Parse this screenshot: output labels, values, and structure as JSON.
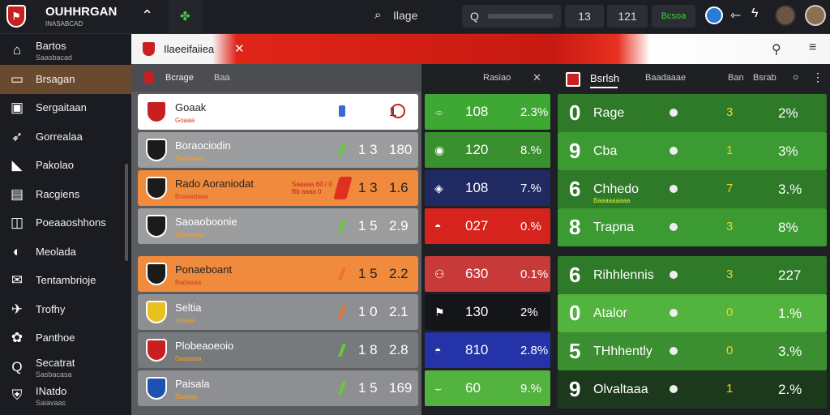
{
  "app": {
    "title": "OUHHRGAN",
    "subtitle": "INASABCAD"
  },
  "topbar": {
    "search_label": "Ilage",
    "search2_placeholder": "Q",
    "box1": "13",
    "box2": "121",
    "box3": "Bcsoa"
  },
  "sidebar": {
    "items": [
      {
        "label": "Bartos",
        "sub": "Saasbacad",
        "icon": "home-icon"
      },
      {
        "label": "Brsagan",
        "sub": "",
        "icon": "wallet-icon"
      },
      {
        "label": "Sergaitaan",
        "sub": "",
        "icon": "card-icon"
      },
      {
        "label": "Gorrealaa",
        "sub": "",
        "icon": "arrow-icon"
      },
      {
        "label": "Pakolao",
        "sub": "",
        "icon": "shoe-icon"
      },
      {
        "label": "Racgiens",
        "sub": "",
        "icon": "news-icon"
      },
      {
        "label": "Poeaaoshhons",
        "sub": "",
        "icon": "square-icon"
      },
      {
        "label": "Meolada",
        "sub": "",
        "icon": "shield-icon"
      },
      {
        "label": "Tentambrioje",
        "sub": "",
        "icon": "mail-icon"
      },
      {
        "label": "Trofhy",
        "sub": "",
        "icon": "plane-icon"
      },
      {
        "label": "Panthoe",
        "sub": "",
        "icon": "gear-icon"
      },
      {
        "label": "Secatrat",
        "sub": "Sasbacasa",
        "icon": "q-icon"
      },
      {
        "label": "INatdo",
        "sub": "Saiavaas",
        "icon": "club-crest-icon"
      }
    ]
  },
  "banner": {
    "title": "Ilaeeifaiiea"
  },
  "left_panel": {
    "header": {
      "col1": "Bcrage",
      "col2": "Baa",
      "col3": "Rasiao"
    },
    "rows": [
      {
        "team": "Goaak",
        "sub": "Goaaa",
        "v1": "",
        "v2": "1",
        "bg": "#ffffff",
        "fg": "#222",
        "crest": "#c82020"
      },
      {
        "team": "Boraociodin",
        "sub": "Baaaaaaa",
        "v1": "1 3",
        "v2": "180",
        "bg": "#9c9d9f",
        "fg": "#fff",
        "crest": "#1b1b1b"
      },
      {
        "team": "Rado Aoraniodat",
        "sub": "Boaaadaaa",
        "v1": "1 3",
        "v2": "1.6",
        "bg": "#f08a3c",
        "fg": "#222",
        "crest": "#1b1b1b",
        "note": "Saaaaa 60 / 0 Bb aaaa 0"
      },
      {
        "team": "Saoaoboonie",
        "sub": "Baaaaaaa",
        "v1": "1 5",
        "v2": "2.9",
        "bg": "#9c9d9f",
        "fg": "#fff",
        "crest": "#1b1b1b"
      },
      {
        "team": "Ponaeboant",
        "sub": "Badaaaa",
        "v1": "1 5",
        "v2": "2.2",
        "bg": "#f08a3c",
        "fg": "#222",
        "crest": "#1b1b1b"
      },
      {
        "team": "Seltia",
        "sub": "Ionaaa",
        "v1": "1 0",
        "v2": "2.1",
        "bg": "#8e8f92",
        "fg": "#fff",
        "crest": "#e8c020"
      },
      {
        "team": "Plobeaoeoio",
        "sub": "Daaaaaa",
        "v1": "1 8",
        "v2": "2.8",
        "bg": "#777a7d",
        "fg": "#fff",
        "crest": "#c82020"
      },
      {
        "team": "Paisala",
        "sub": "Bbaaaa",
        "v1": "1 5",
        "v2": "169",
        "bg": "#8e8f92",
        "fg": "#fff",
        "crest": "#2050b0"
      }
    ]
  },
  "middle": {
    "rows": [
      {
        "a": "108",
        "b": "2.3%",
        "bg": "#3fa834"
      },
      {
        "a": "120",
        "b": "8.%",
        "bg": "#3a8f2e"
      },
      {
        "a": "108",
        "b": "7.%",
        "bg": "#1f2a63"
      },
      {
        "a": "027",
        "b": "0.%",
        "bg": "#d6231d"
      },
      {
        "a": "630",
        "b": "0.1%",
        "bg": "#c83a3a"
      },
      {
        "a": "130",
        "b": "2%",
        "bg": "#141518"
      },
      {
        "a": "810",
        "b": "2.8%",
        "bg": "#2433a8"
      },
      {
        "a": "60",
        "b": "9.%",
        "bg": "#52b33e"
      }
    ]
  },
  "right_panel": {
    "header": {
      "title": "Bsrlsh",
      "col2": "Baadaaae",
      "col3": "Ban",
      "col4": "Bsrab"
    },
    "rows": [
      {
        "big": "0",
        "name": "Rage",
        "m": "3",
        "pct": "2%",
        "bg": "#2f7a29"
      },
      {
        "big": "9",
        "name": "Cba",
        "m": "1",
        "pct": "3%",
        "bg": "#3b9a31"
      },
      {
        "big": "6",
        "name": "Chhedo",
        "m": "7",
        "pct": "3.%",
        "bg": "#2f7a29",
        "sub": "Baaaaaaaaa"
      },
      {
        "big": "8",
        "name": "Trapna",
        "m": "3",
        "pct": "8%",
        "bg": "#3b9a31"
      },
      {
        "big": "6",
        "name": "Rihhlennis",
        "m": "3",
        "pct": "227",
        "bg": "#2f7a29"
      },
      {
        "big": "0",
        "name": "Atalor",
        "m": "0",
        "pct": "1.%",
        "bg": "#52b33e"
      },
      {
        "big": "5",
        "name": "THhhently",
        "m": "0",
        "pct": "3.%",
        "bg": "#3b8f30"
      },
      {
        "big": "9",
        "name": "Olvaltaaa",
        "m": "1",
        "pct": "2.%",
        "bg": "#1c3a1b"
      }
    ]
  }
}
